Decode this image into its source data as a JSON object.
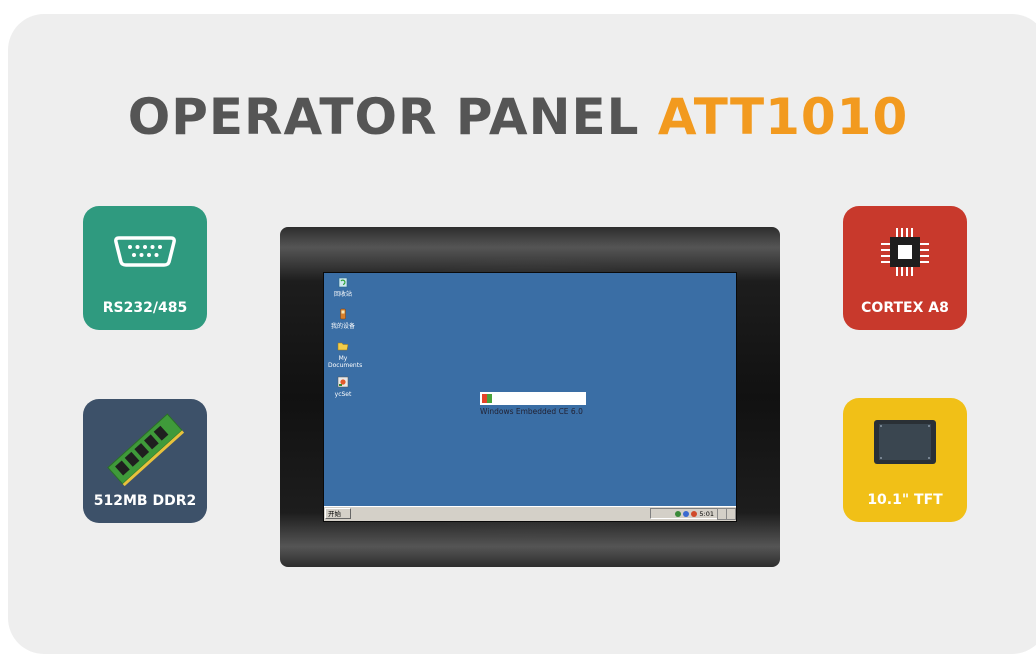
{
  "title": {
    "main": "OPERATOR PANEL",
    "accent": "ATT1010"
  },
  "colors": {
    "title": "#555555",
    "accent": "#f29a1f",
    "rs": "#2f9a7f",
    "ddr": "#3d5169",
    "cpu": "#c8392c",
    "tft": "#f1c017",
    "desktop": "#3a6ea5"
  },
  "features": {
    "rs": {
      "label": "RS232/485",
      "icon": "serial-port-icon"
    },
    "ddr": {
      "label": "512MB DDR2",
      "icon": "ram-module-icon"
    },
    "cpu": {
      "label": "CORTEX A8",
      "icon": "cpu-chip-icon"
    },
    "tft": {
      "label": "10.1\" TFT",
      "icon": "display-panel-icon"
    }
  },
  "desktop": {
    "icons": [
      {
        "label": "回收站",
        "icon": "recycle-bin-icon"
      },
      {
        "label": "我的设备",
        "icon": "my-device-icon"
      },
      {
        "label": "My Documents",
        "icon": "folder-icon"
      },
      {
        "label": "ycSet",
        "icon": "settings-app-icon"
      }
    ],
    "os_label": "Windows Embedded CE 6.0",
    "start_label": "开始",
    "clock": "5:01"
  }
}
